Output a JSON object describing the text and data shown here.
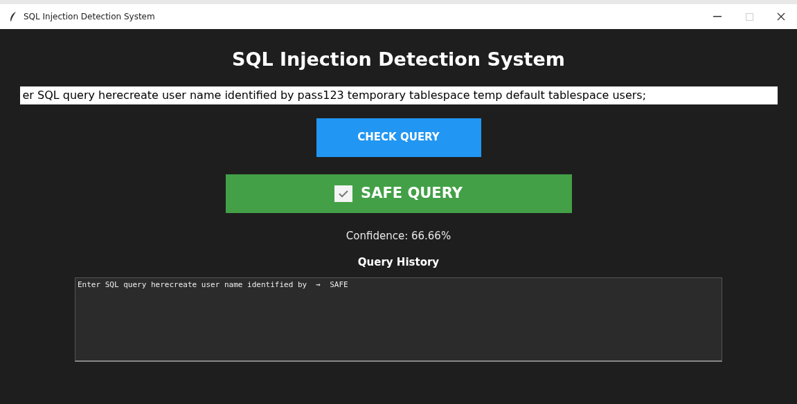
{
  "window": {
    "title": "SQL Injection Detection System"
  },
  "heading": "SQL Injection Detection System",
  "query_input": {
    "value": "er SQL query herecreate user name identified by pass123 temporary tablespace temp default tablespace users;"
  },
  "check_button": {
    "label": "CHECK QUERY"
  },
  "result": {
    "safe": true,
    "label": "SAFE QUERY"
  },
  "confidence": "Confidence: 66.66%",
  "history": {
    "title": "Query History",
    "entries": [
      "Enter SQL query herecreate user name identified by  →  SAFE"
    ]
  }
}
